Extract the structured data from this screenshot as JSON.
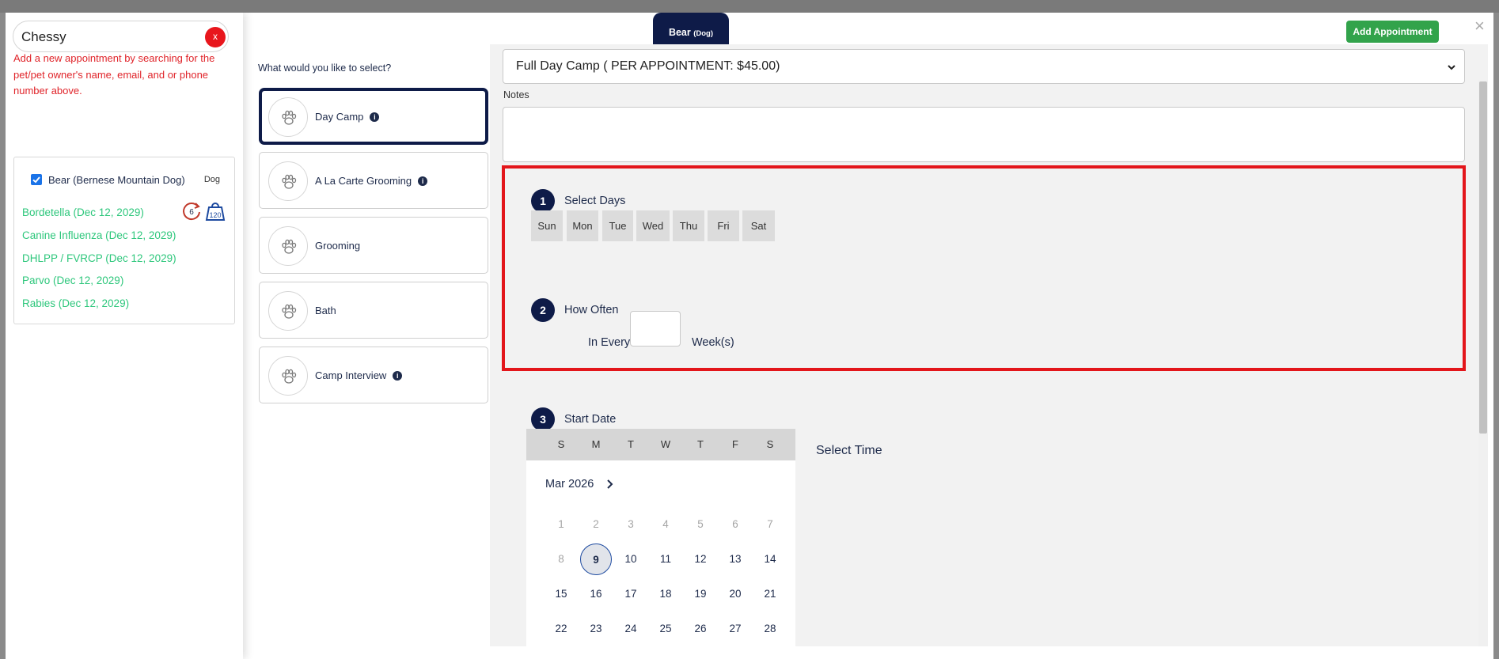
{
  "search": {
    "value": "Chessy",
    "clear_label": "x"
  },
  "helper_text": "Add a new appointment by searching for the pet/pet owner's name, email, and or phone number above.",
  "pet": {
    "name": "Bear (Bernese Mountain Dog)",
    "species": "Dog",
    "badge_count": "6",
    "badge_weight": "120",
    "vaccinations": [
      "Bordetella (Dec 12, 2029)",
      "Canine Influenza (Dec 12, 2029)",
      "DHLPP / FVRCP (Dec 12, 2029)",
      "Parvo (Dec 12, 2029)",
      "Rabies (Dec 12, 2029)"
    ]
  },
  "services": {
    "heading": "What would you like to select?",
    "items": [
      {
        "label": "Day Camp"
      },
      {
        "label": "A La Carte Grooming"
      },
      {
        "label": "Grooming"
      },
      {
        "label": "Bath"
      },
      {
        "label": "Camp Interview"
      }
    ],
    "info_glyph": "i"
  },
  "topbar": {
    "pet_tab": "Bear",
    "pet_tab_species": "(Dog)",
    "add_button": "Add Appointment",
    "close_glyph": "×"
  },
  "form": {
    "appointment_type": "Full Day Camp ( PER APPOINTMENT: $45.00)",
    "notes_label": "Notes",
    "step1": {
      "num": "1",
      "label": "Select Days"
    },
    "days": [
      "Sun",
      "Mon",
      "Tue",
      "Wed",
      "Thu",
      "Fri",
      "Sat"
    ],
    "step2": {
      "num": "2",
      "label": "How Often"
    },
    "freq_prefix": "In Every",
    "freq_suffix": "Week(s)",
    "step3": {
      "num": "3",
      "label": "Start Date"
    },
    "select_time": "Select Time"
  },
  "calendar": {
    "weekdays": [
      "S",
      "M",
      "T",
      "W",
      "T",
      "F",
      "S"
    ],
    "month": "Mar 2026",
    "weeks": [
      [
        "1",
        "2",
        "3",
        "4",
        "5",
        "6",
        "7"
      ],
      [
        "8",
        "9",
        "10",
        "11",
        "12",
        "13",
        "14"
      ],
      [
        "15",
        "16",
        "17",
        "18",
        "19",
        "20",
        "21"
      ],
      [
        "22",
        "23",
        "24",
        "25",
        "26",
        "27",
        "28"
      ]
    ],
    "selected": "9"
  },
  "colors": {
    "navy": "#0e1b48",
    "green_button": "#32a34b",
    "vaccine_green": "#2ec77c",
    "alert_red": "#e3161b"
  }
}
